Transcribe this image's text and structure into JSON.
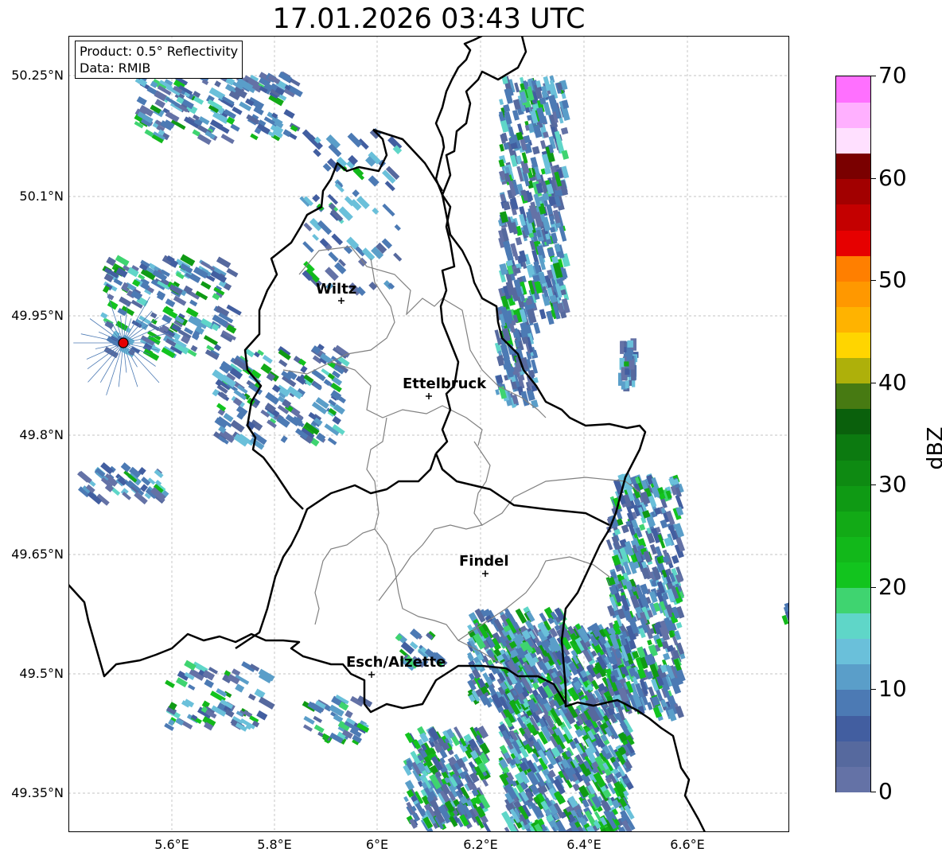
{
  "title": "17.01.2026 03:43 UTC",
  "info_box": {
    "product": "Product: 0.5° Reflectivity",
    "data": "Data: RMIB"
  },
  "lat_ticks": [
    "50.25°N",
    "50.1°N",
    "49.95°N",
    "49.8°N",
    "49.65°N",
    "49.5°N",
    "49.35°N"
  ],
  "lon_ticks": [
    "5.6°E",
    "5.8°E",
    "6°E",
    "6.2°E",
    "6.4°E",
    "6.6°E"
  ],
  "cities": [
    {
      "name": "Wiltz"
    },
    {
      "name": "Ettelbruck"
    },
    {
      "name": "Findel"
    },
    {
      "name": "Esch/Alzette"
    }
  ],
  "colorbar": {
    "label": "dBZ",
    "ticks": [
      "70",
      "60",
      "50",
      "40",
      "30",
      "20",
      "10",
      "0"
    ],
    "min": 0,
    "max": 70,
    "step": 2.5,
    "colors": [
      "#6472a6",
      "#56699e",
      "#425ea0",
      "#4c7ab4",
      "#5a9ec9",
      "#6ac0da",
      "#5fd6c8",
      "#3fd470",
      "#12c41e",
      "#12b81a",
      "#12aa16",
      "#0f9a14",
      "#0e8a12",
      "#0c7a10",
      "#0a600c",
      "#477a12",
      "#aeb00a",
      "#ffd500",
      "#ffb300",
      "#ff9800",
      "#ff7f00",
      "#e60000",
      "#c40000",
      "#a20000",
      "#7a0000",
      "#ffe0ff",
      "#ffb0ff",
      "#ff70ff",
      "#f03cf0"
    ]
  },
  "radar_site_color": "#e60000"
}
